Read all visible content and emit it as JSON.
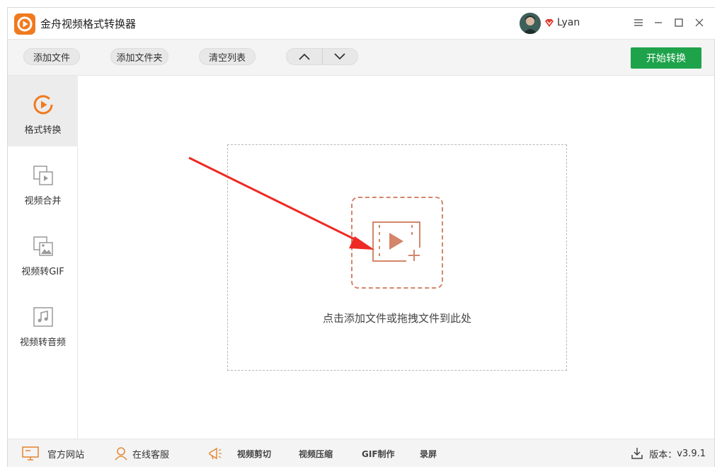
{
  "app": {
    "title": "金舟视频格式转换器",
    "username": "Lyan",
    "accent_color": "#f07a1f"
  },
  "toolbar": {
    "add_file": "添加文件",
    "add_folder": "添加文件夹",
    "clear_list": "清空列表",
    "start": "开始转换",
    "start_color": "#1ea34b"
  },
  "sidebar": {
    "items": [
      {
        "label": "格式转换",
        "icon": "format-convert-icon",
        "active": true
      },
      {
        "label": "视频合并",
        "icon": "video-merge-icon"
      },
      {
        "label": "视频转GIF",
        "icon": "video-to-gif-icon"
      },
      {
        "label": "视频转音频",
        "icon": "video-to-audio-icon"
      }
    ]
  },
  "main": {
    "drop_text": "点击添加文件或拖拽文件到此处"
  },
  "footer": {
    "website": "官方网站",
    "support": "在线客服",
    "tools": [
      "视频剪切",
      "视频压缩",
      "GIF制作",
      "录屏"
    ],
    "version_label": "版本：",
    "version": "v3.9.1"
  }
}
